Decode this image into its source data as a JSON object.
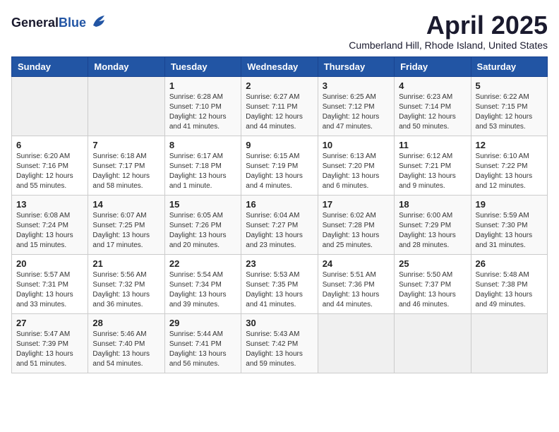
{
  "header": {
    "logo_line1": "General",
    "logo_line2": "Blue",
    "month": "April 2025",
    "location": "Cumberland Hill, Rhode Island, United States"
  },
  "weekdays": [
    "Sunday",
    "Monday",
    "Tuesday",
    "Wednesday",
    "Thursday",
    "Friday",
    "Saturday"
  ],
  "weeks": [
    [
      {
        "day": "",
        "sunrise": "",
        "sunset": "",
        "daylight": "",
        "empty": true
      },
      {
        "day": "",
        "sunrise": "",
        "sunset": "",
        "daylight": "",
        "empty": true
      },
      {
        "day": "1",
        "sunrise": "Sunrise: 6:28 AM",
        "sunset": "Sunset: 7:10 PM",
        "daylight": "Daylight: 12 hours and 41 minutes."
      },
      {
        "day": "2",
        "sunrise": "Sunrise: 6:27 AM",
        "sunset": "Sunset: 7:11 PM",
        "daylight": "Daylight: 12 hours and 44 minutes."
      },
      {
        "day": "3",
        "sunrise": "Sunrise: 6:25 AM",
        "sunset": "Sunset: 7:12 PM",
        "daylight": "Daylight: 12 hours and 47 minutes."
      },
      {
        "day": "4",
        "sunrise": "Sunrise: 6:23 AM",
        "sunset": "Sunset: 7:14 PM",
        "daylight": "Daylight: 12 hours and 50 minutes."
      },
      {
        "day": "5",
        "sunrise": "Sunrise: 6:22 AM",
        "sunset": "Sunset: 7:15 PM",
        "daylight": "Daylight: 12 hours and 53 minutes."
      }
    ],
    [
      {
        "day": "6",
        "sunrise": "Sunrise: 6:20 AM",
        "sunset": "Sunset: 7:16 PM",
        "daylight": "Daylight: 12 hours and 55 minutes."
      },
      {
        "day": "7",
        "sunrise": "Sunrise: 6:18 AM",
        "sunset": "Sunset: 7:17 PM",
        "daylight": "Daylight: 12 hours and 58 minutes."
      },
      {
        "day": "8",
        "sunrise": "Sunrise: 6:17 AM",
        "sunset": "Sunset: 7:18 PM",
        "daylight": "Daylight: 13 hours and 1 minute."
      },
      {
        "day": "9",
        "sunrise": "Sunrise: 6:15 AM",
        "sunset": "Sunset: 7:19 PM",
        "daylight": "Daylight: 13 hours and 4 minutes."
      },
      {
        "day": "10",
        "sunrise": "Sunrise: 6:13 AM",
        "sunset": "Sunset: 7:20 PM",
        "daylight": "Daylight: 13 hours and 6 minutes."
      },
      {
        "day": "11",
        "sunrise": "Sunrise: 6:12 AM",
        "sunset": "Sunset: 7:21 PM",
        "daylight": "Daylight: 13 hours and 9 minutes."
      },
      {
        "day": "12",
        "sunrise": "Sunrise: 6:10 AM",
        "sunset": "Sunset: 7:22 PM",
        "daylight": "Daylight: 13 hours and 12 minutes."
      }
    ],
    [
      {
        "day": "13",
        "sunrise": "Sunrise: 6:08 AM",
        "sunset": "Sunset: 7:24 PM",
        "daylight": "Daylight: 13 hours and 15 minutes."
      },
      {
        "day": "14",
        "sunrise": "Sunrise: 6:07 AM",
        "sunset": "Sunset: 7:25 PM",
        "daylight": "Daylight: 13 hours and 17 minutes."
      },
      {
        "day": "15",
        "sunrise": "Sunrise: 6:05 AM",
        "sunset": "Sunset: 7:26 PM",
        "daylight": "Daylight: 13 hours and 20 minutes."
      },
      {
        "day": "16",
        "sunrise": "Sunrise: 6:04 AM",
        "sunset": "Sunset: 7:27 PM",
        "daylight": "Daylight: 13 hours and 23 minutes."
      },
      {
        "day": "17",
        "sunrise": "Sunrise: 6:02 AM",
        "sunset": "Sunset: 7:28 PM",
        "daylight": "Daylight: 13 hours and 25 minutes."
      },
      {
        "day": "18",
        "sunrise": "Sunrise: 6:00 AM",
        "sunset": "Sunset: 7:29 PM",
        "daylight": "Daylight: 13 hours and 28 minutes."
      },
      {
        "day": "19",
        "sunrise": "Sunrise: 5:59 AM",
        "sunset": "Sunset: 7:30 PM",
        "daylight": "Daylight: 13 hours and 31 minutes."
      }
    ],
    [
      {
        "day": "20",
        "sunrise": "Sunrise: 5:57 AM",
        "sunset": "Sunset: 7:31 PM",
        "daylight": "Daylight: 13 hours and 33 minutes."
      },
      {
        "day": "21",
        "sunrise": "Sunrise: 5:56 AM",
        "sunset": "Sunset: 7:32 PM",
        "daylight": "Daylight: 13 hours and 36 minutes."
      },
      {
        "day": "22",
        "sunrise": "Sunrise: 5:54 AM",
        "sunset": "Sunset: 7:34 PM",
        "daylight": "Daylight: 13 hours and 39 minutes."
      },
      {
        "day": "23",
        "sunrise": "Sunrise: 5:53 AM",
        "sunset": "Sunset: 7:35 PM",
        "daylight": "Daylight: 13 hours and 41 minutes."
      },
      {
        "day": "24",
        "sunrise": "Sunrise: 5:51 AM",
        "sunset": "Sunset: 7:36 PM",
        "daylight": "Daylight: 13 hours and 44 minutes."
      },
      {
        "day": "25",
        "sunrise": "Sunrise: 5:50 AM",
        "sunset": "Sunset: 7:37 PM",
        "daylight": "Daylight: 13 hours and 46 minutes."
      },
      {
        "day": "26",
        "sunrise": "Sunrise: 5:48 AM",
        "sunset": "Sunset: 7:38 PM",
        "daylight": "Daylight: 13 hours and 49 minutes."
      }
    ],
    [
      {
        "day": "27",
        "sunrise": "Sunrise: 5:47 AM",
        "sunset": "Sunset: 7:39 PM",
        "daylight": "Daylight: 13 hours and 51 minutes."
      },
      {
        "day": "28",
        "sunrise": "Sunrise: 5:46 AM",
        "sunset": "Sunset: 7:40 PM",
        "daylight": "Daylight: 13 hours and 54 minutes."
      },
      {
        "day": "29",
        "sunrise": "Sunrise: 5:44 AM",
        "sunset": "Sunset: 7:41 PM",
        "daylight": "Daylight: 13 hours and 56 minutes."
      },
      {
        "day": "30",
        "sunrise": "Sunrise: 5:43 AM",
        "sunset": "Sunset: 7:42 PM",
        "daylight": "Daylight: 13 hours and 59 minutes."
      },
      {
        "day": "",
        "sunrise": "",
        "sunset": "",
        "daylight": "",
        "empty": true
      },
      {
        "day": "",
        "sunrise": "",
        "sunset": "",
        "daylight": "",
        "empty": true
      },
      {
        "day": "",
        "sunrise": "",
        "sunset": "",
        "daylight": "",
        "empty": true
      }
    ]
  ]
}
